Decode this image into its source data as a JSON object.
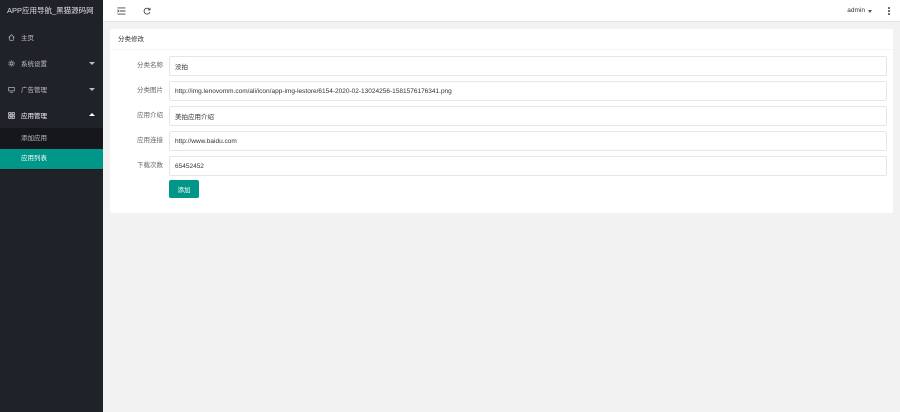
{
  "app": {
    "title": "APP应用导航_黑猫源码网"
  },
  "sidebar": {
    "items": [
      {
        "label": "主页",
        "icon": "home-icon"
      },
      {
        "label": "系统设置",
        "icon": "gear-icon"
      },
      {
        "label": "广告管理",
        "icon": "monitor-icon"
      },
      {
        "label": "应用管理",
        "icon": "grid-icon"
      }
    ],
    "submenu": [
      {
        "label": "添加应用"
      },
      {
        "label": "应用列表"
      }
    ]
  },
  "header": {
    "user": "admin"
  },
  "card": {
    "title": "分类修改",
    "fields": [
      {
        "label": "分类名称",
        "value": "没拍"
      },
      {
        "label": "分类图片",
        "value": "http://img.lenovomm.com/ali/icon/app-img-lestore/6154-2020-02-13024256-1581576176341.png"
      },
      {
        "label": "应用介绍",
        "value": "美拍应用介绍"
      },
      {
        "label": "应用连接",
        "value": "http://www.baidu.com"
      },
      {
        "label": "下载次数",
        "value": "65452452"
      }
    ],
    "submit_label": "添加"
  },
  "colors": {
    "accent": "#009688",
    "sidebar_bg": "#20222a",
    "page_bg": "#f2f2f2"
  }
}
